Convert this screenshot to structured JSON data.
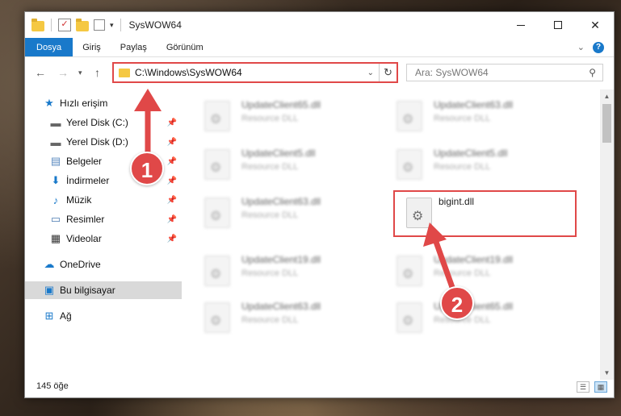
{
  "titlebar": {
    "title": "SysWOW64",
    "minimize": "—",
    "maximize": "□",
    "close": "✕"
  },
  "ribbon": {
    "tabs": [
      "Dosya",
      "Giriş",
      "Paylaş",
      "Görünüm"
    ],
    "expand": "⌄",
    "help": "?"
  },
  "address": {
    "path": "C:\\Windows\\SysWOW64",
    "search_placeholder": "Ara: SysWOW64"
  },
  "nav": {
    "items": [
      {
        "label": "Hızlı erişim",
        "icon": "star-icon",
        "pinned": false
      },
      {
        "label": "Yerel Disk (C:)",
        "icon": "drive-icon",
        "pinned": true
      },
      {
        "label": "Yerel Disk (D:)",
        "icon": "drive-icon",
        "pinned": true
      },
      {
        "label": "Belgeler",
        "icon": "documents-icon",
        "pinned": true
      },
      {
        "label": "İndirmeler",
        "icon": "download-icon",
        "pinned": true
      },
      {
        "label": "Müzik",
        "icon": "music-icon",
        "pinned": true
      },
      {
        "label": "Resimler",
        "icon": "pictures-icon",
        "pinned": true
      },
      {
        "label": "Videolar",
        "icon": "videos-icon",
        "pinned": true
      },
      {
        "label": "OneDrive",
        "icon": "cloud-icon",
        "pinned": false
      },
      {
        "label": "Bu bilgisayar",
        "icon": "computer-icon",
        "pinned": false
      },
      {
        "label": "Ağ",
        "icon": "network-icon",
        "pinned": false
      }
    ]
  },
  "files": [
    {
      "name": "UpdateClient65.dll",
      "desc": "Resource DLL"
    },
    {
      "name": "UpdateClient63.dll",
      "desc": "Resource DLL"
    },
    {
      "name": "UpdateClient5.dll",
      "desc": "Resource DLL"
    },
    {
      "name": "UpdateClient5.dll",
      "desc": "Resource DLL"
    },
    {
      "name": "UpdateClient63.dll",
      "desc": "Resource DLL"
    },
    {
      "name": "bigint.dll",
      "desc": ""
    },
    {
      "name": "UpdateClient19.dll",
      "desc": "Resource DLL"
    },
    {
      "name": "UpdateClient19.dll",
      "desc": "Resource DLL"
    },
    {
      "name": "UpdateClient63.dll",
      "desc": "Resource DLL"
    },
    {
      "name": "UpdateClient65.dll",
      "desc": "Resource DLL"
    }
  ],
  "status": {
    "count": "145 öğe"
  },
  "annotations": {
    "step1": "1",
    "step2": "2",
    "color": "#e04848"
  }
}
